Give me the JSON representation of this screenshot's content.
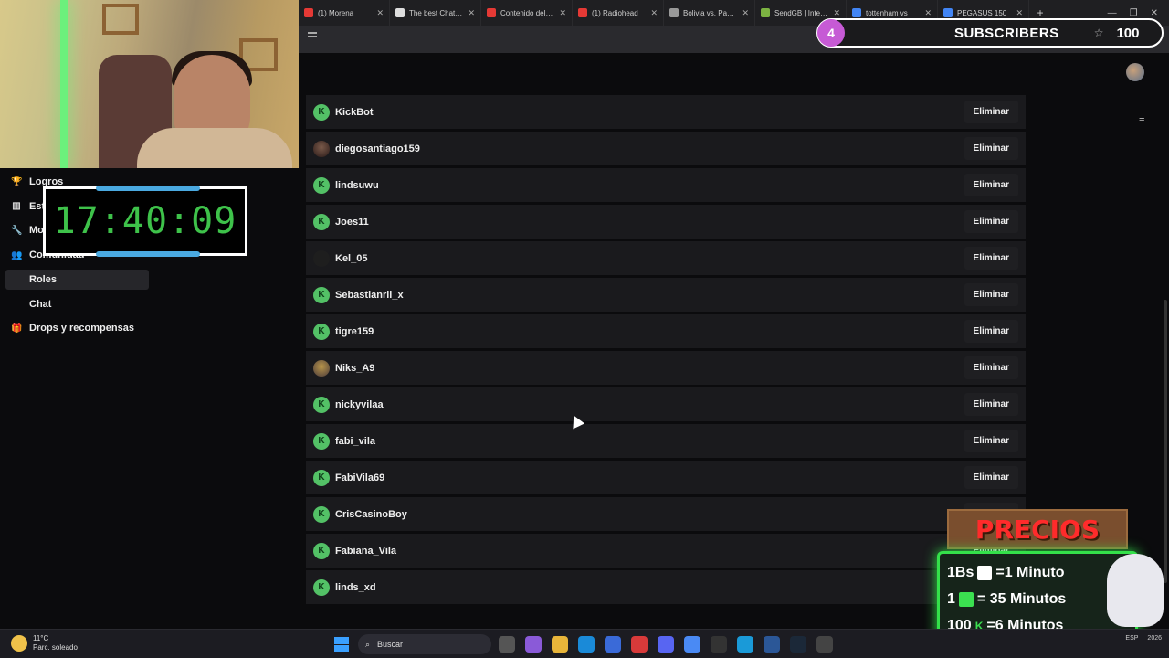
{
  "browser": {
    "tabs": [
      {
        "title": "(1) Morena",
        "color": "#e53935"
      },
      {
        "title": "The best Chatbot",
        "color": "#dddddd"
      },
      {
        "title": "Contenido del canal",
        "color": "#e53935"
      },
      {
        "title": "(1) Radiohead",
        "color": "#e53935"
      },
      {
        "title": "Bolivia vs. Panamá",
        "color": "#999999"
      },
      {
        "title": "SendGB | Internet",
        "color": "#7cb342"
      },
      {
        "title": "tottenham vs",
        "color": "#4285f4"
      },
      {
        "title": "PEGASUS 150",
        "color": "#4285f4"
      }
    ],
    "newtab": "+"
  },
  "subscribers": {
    "count": "4",
    "label": "SUBSCRIBERS",
    "goal": "100"
  },
  "timer": {
    "time": "17:40:09"
  },
  "sidebar": {
    "items": [
      {
        "label": "Logros",
        "icon": "trophy-icon"
      },
      {
        "label": "Estudio",
        "icon": "studio-icon"
      },
      {
        "label": "Moderación",
        "icon": "wrench-icon"
      },
      {
        "label": "Comunidad",
        "icon": "community-icon"
      },
      {
        "label": "Roles",
        "icon": ""
      },
      {
        "label": "Chat",
        "icon": ""
      },
      {
        "label": "Drops y recompensas",
        "icon": "gift-icon"
      }
    ]
  },
  "roles": {
    "action_label": "Eliminar",
    "users": [
      {
        "name": "KickBot",
        "avatar": "kick"
      },
      {
        "name": "diegosantiago159",
        "avatar": "photo"
      },
      {
        "name": "lindsuwu",
        "avatar": "kick"
      },
      {
        "name": "Joes11",
        "avatar": "kick"
      },
      {
        "name": "Kel_05",
        "avatar": "dark"
      },
      {
        "name": "Sebastianrll_x",
        "avatar": "kick"
      },
      {
        "name": "tigre159",
        "avatar": "kick"
      },
      {
        "name": "Niks_A9",
        "avatar": "gold"
      },
      {
        "name": "nickyvilaa",
        "avatar": "kick"
      },
      {
        "name": "fabi_vila",
        "avatar": "kick"
      },
      {
        "name": "FabiVila69",
        "avatar": "kick"
      },
      {
        "name": "CrisCasinoBoy",
        "avatar": "kick"
      },
      {
        "name": "Fabiana_Vila",
        "avatar": "kick"
      },
      {
        "name": "linds_xd",
        "avatar": "kick"
      }
    ]
  },
  "prices": {
    "title": "PRECIOS",
    "lines": [
      {
        "left": "1Bs",
        "right": "=1 Minuto"
      },
      {
        "left": "1",
        "right": "= 35 Minutos"
      },
      {
        "left": "100",
        "right": "=6 Minutos"
      }
    ]
  },
  "taskbar": {
    "weather_temp": "11°C",
    "weather_desc": "Parc. soleado",
    "search_label": "Buscar",
    "lang": "ESP",
    "year": "2026"
  }
}
